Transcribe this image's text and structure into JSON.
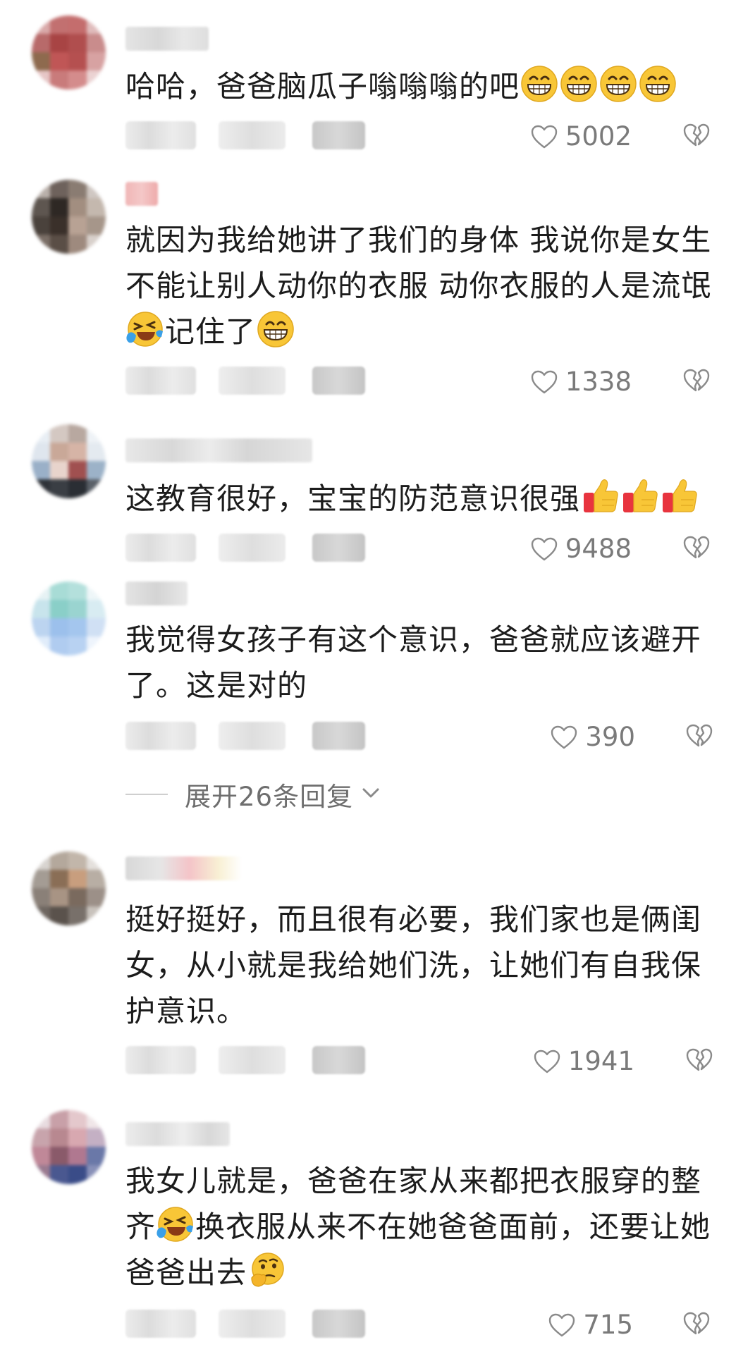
{
  "comments": [
    {
      "text_parts": [
        "哈哈，爸爸脑瓜子嗡嗡嗡的吧",
        "[grin]",
        "[grin]",
        "[grin]",
        "[grin]"
      ],
      "likes": "5002"
    },
    {
      "text_parts": [
        "就因为我给她讲了我们的身体 我说你是女生不能让别人动你的衣服 动你衣服的人是流氓",
        "[laugh-cry]",
        "记住了",
        "[grin]"
      ],
      "likes": "1338"
    },
    {
      "text_parts": [
        "这教育很好，宝宝的防范意识很强",
        "[thumbs-up]",
        "[thumbs-up]",
        "[thumbs-up]"
      ],
      "likes": "9488"
    },
    {
      "text_parts": [
        "我觉得女孩子有这个意识，爸爸就应该避开了。这是对的"
      ],
      "likes": "390"
    },
    {
      "text_parts": [
        "挺好挺好，而且很有必要，我们家也是俩闺女，从小就是我给她们洗，让她们有自我保护意识。"
      ],
      "likes": "1941"
    },
    {
      "text_parts": [
        "我女儿就是，爸爸在家从来都把衣服穿的整齐",
        "[laugh-cry]",
        "换衣服从来不在她爸爸面前，还要让她爸爸出去",
        "[thinking]"
      ],
      "likes": "715"
    }
  ],
  "expand_replies": {
    "label": "展开26条回复"
  },
  "icons": {
    "like": "heart-outline-icon",
    "dislike": "broken-heart-icon",
    "expand": "chevron-down-icon"
  },
  "colors": {
    "text": "#1c1c1c",
    "meta": "#7a7a7a",
    "emoji": "#f7c531"
  }
}
